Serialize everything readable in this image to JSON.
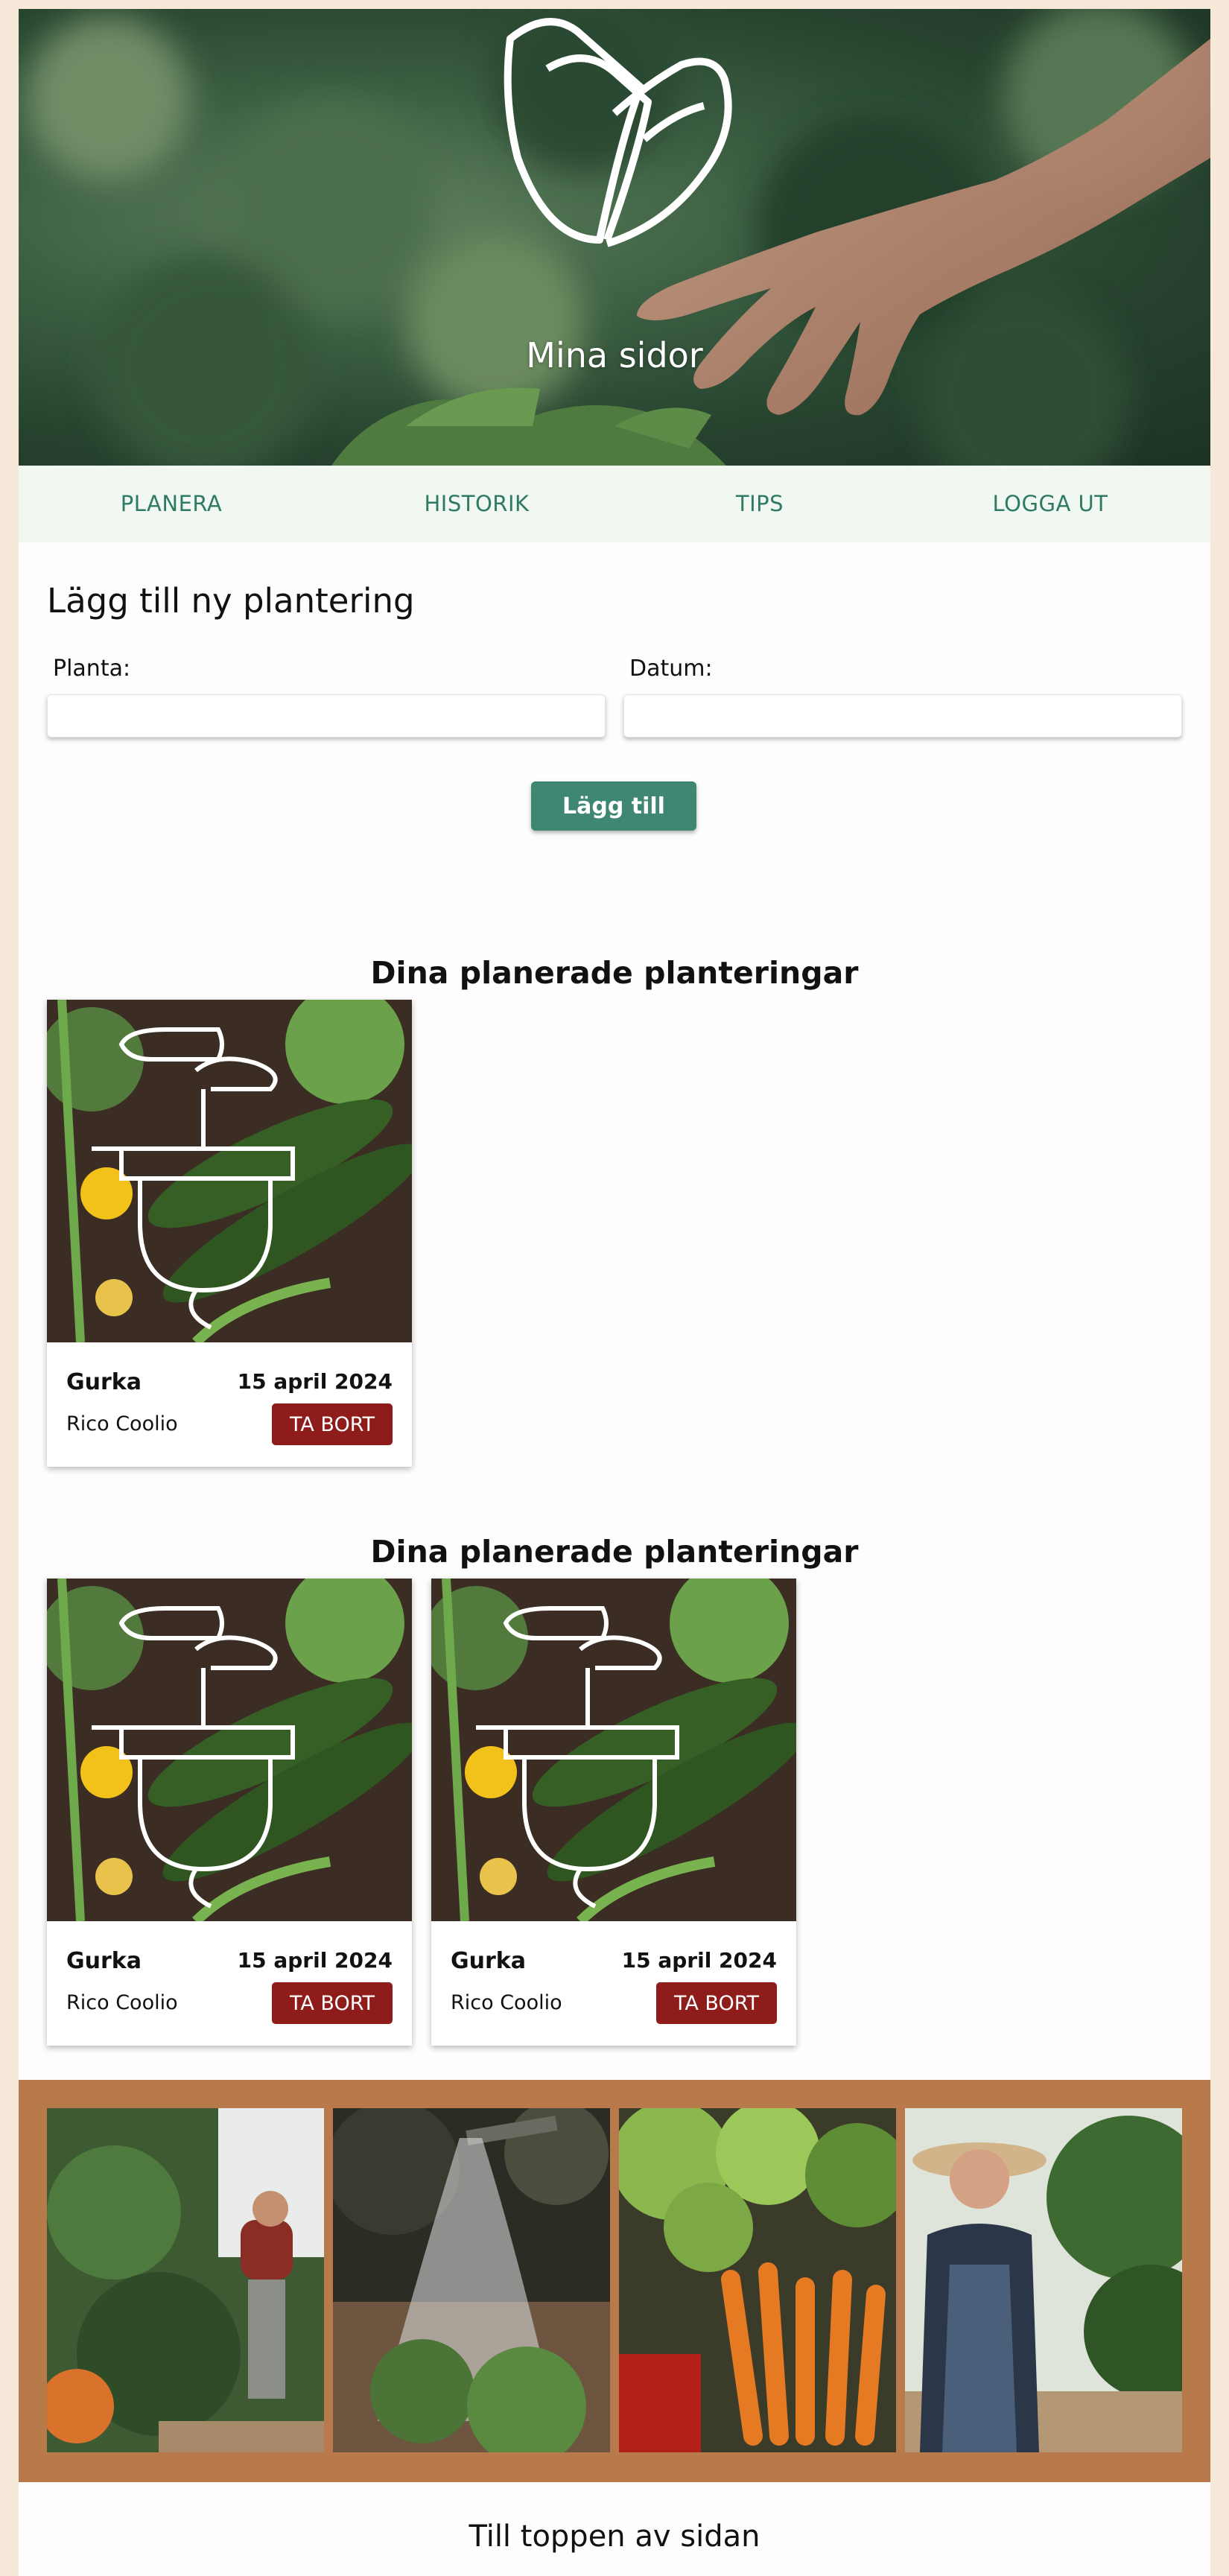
{
  "hero": {
    "title": "Mina sidor"
  },
  "nav": {
    "items": [
      "PLANERA",
      "HISTORIK",
      "TIPS",
      "LOGGA UT"
    ]
  },
  "form": {
    "title": "Lägg till ny plantering",
    "plant_label": "Planta:",
    "plant_value": "",
    "date_label": "Datum:",
    "date_value": "",
    "submit_label": "Lägg till"
  },
  "sections": [
    {
      "title": "Dina planerade planteringar",
      "cards": [
        {
          "name": "Gurka",
          "date": "15 april 2024",
          "owner": "Rico Coolio",
          "remove_label": "TA BORT"
        }
      ]
    },
    {
      "title": "Dina planerade planteringar",
      "cards": [
        {
          "name": "Gurka",
          "date": "15 april 2024",
          "owner": "Rico Coolio",
          "remove_label": "TA BORT"
        },
        {
          "name": "Gurka",
          "date": "15 april 2024",
          "owner": "Rico Coolio",
          "remove_label": "TA BORT"
        }
      ]
    }
  ],
  "footer": {
    "back_to_top": "Till toppen av sidan"
  },
  "colors": {
    "accent": "#3f8673",
    "nav_text": "#2f7a64",
    "danger": "#8e1c1a",
    "gallery_bg": "#b97a4b",
    "nav_bg": "#f1f8f2"
  }
}
